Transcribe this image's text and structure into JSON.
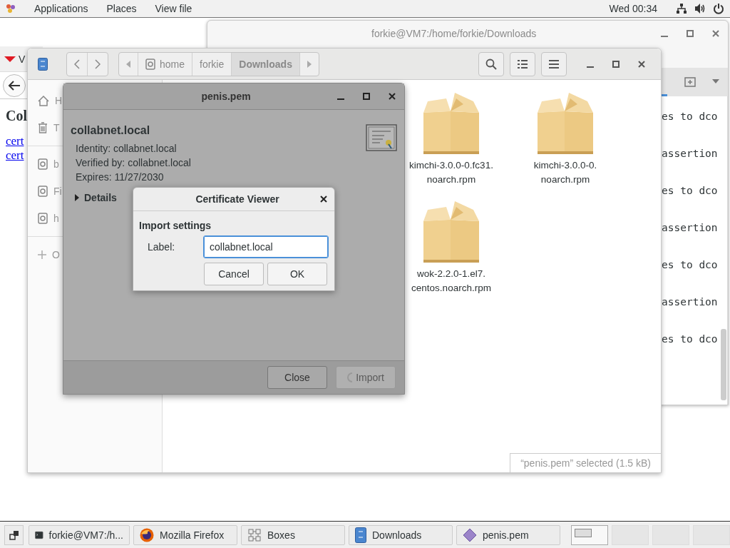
{
  "top_bar": {
    "menus": [
      "Applications",
      "Places",
      "View file"
    ],
    "clock": "Wed 00:34"
  },
  "terminal": {
    "title": "forkie@VM7:/home/forkie/Downloads",
    "lines": [
      "es to dco",
      "assertion",
      "es to dco",
      "assertion",
      "es to dco",
      "assertion",
      "es to dco"
    ]
  },
  "browser": {
    "tab": "V",
    "heading": "Col",
    "links": [
      "cert",
      "cert"
    ]
  },
  "files": {
    "path": [
      {
        "label": "home",
        "kind": "home",
        "selected": false
      },
      {
        "label": "forkie",
        "kind": "plain",
        "selected": false
      },
      {
        "label": "Downloads",
        "kind": "plain",
        "selected": true
      }
    ],
    "sidebar": [
      {
        "label": "H",
        "kind": "home"
      },
      {
        "label": "T",
        "kind": "trash"
      },
      {
        "label": "b",
        "kind": "drive"
      },
      {
        "label": "Fi",
        "kind": "drive"
      },
      {
        "label": "h",
        "kind": "drive"
      }
    ],
    "other_locations": "O",
    "items": [
      {
        "lines": [
          "kimchi-3.0.0-0.fc31.",
          "noarch.rpm"
        ]
      },
      {
        "lines": [
          "kimchi-3.0.0-0.",
          "noarch.rpm"
        ]
      },
      {
        "lines": [
          "wok-2.2.0-1.el7.",
          "centos.noarch.rpm"
        ]
      }
    ],
    "status": "“penis.pem” selected (1.5 kB)"
  },
  "cert_dialog": {
    "title": "penis.pem",
    "subject": "collabnet.local",
    "fields": [
      "Identity: collabnet.local",
      "Verified by: collabnet.local",
      "Expires: 11/27/2030"
    ],
    "details": {
      "label": "Details",
      "expanded": false
    },
    "buttons": [
      {
        "label": "Close",
        "disabled": false
      },
      {
        "label": "Import",
        "disabled": true
      }
    ]
  },
  "viewer": {
    "title": "Certificate Viewer",
    "section": "Import settings",
    "field_label": "Label:",
    "value": "collabnet.local",
    "buttons": [
      "Cancel",
      "OK"
    ]
  },
  "taskbar": {
    "items": [
      {
        "label": "forkie@VM7:/h...",
        "kind": "terminal"
      },
      {
        "label": "Mozilla Firefox",
        "kind": "firefox"
      },
      {
        "label": "Boxes",
        "kind": "boxes"
      },
      {
        "label": "Downloads",
        "kind": "files"
      },
      {
        "label": "penis.pem",
        "kind": "cert"
      }
    ],
    "workspaces": [
      {
        "selected": true
      },
      {
        "selected": false
      },
      {
        "selected": false
      },
      {
        "selected": false
      }
    ]
  }
}
